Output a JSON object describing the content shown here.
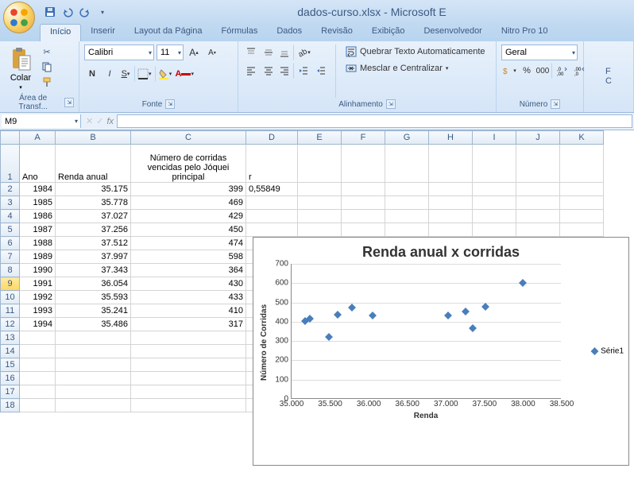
{
  "window": {
    "title": "dados-curso.xlsx - Microsoft E"
  },
  "tabs": {
    "inicio": "Início",
    "inserir": "Inserir",
    "layout": "Layout da Página",
    "formulas": "Fórmulas",
    "dados": "Dados",
    "revisao": "Revisão",
    "exibicao": "Exibição",
    "desenvolvedor": "Desenvolvedor",
    "nitro": "Nitro Pro 10"
  },
  "ribbon": {
    "clipboard": {
      "paste": "Colar",
      "group": "Área de Transf..."
    },
    "font": {
      "name": "Calibri",
      "size": "11",
      "group": "Fonte"
    },
    "align": {
      "wrap": "Quebrar Texto Automaticamente",
      "merge": "Mesclar e Centralizar",
      "group": "Alinhamento"
    },
    "number": {
      "format": "Geral",
      "group": "Número"
    }
  },
  "namebox": "M9",
  "fx": "fx",
  "columns": [
    "A",
    "B",
    "C",
    "D",
    "E",
    "F",
    "G",
    "H",
    "I",
    "J",
    "K"
  ],
  "headers": {
    "A": "Ano",
    "B": "Renda anual",
    "C": "Número de corridas vencidas pelo Jóquei principal",
    "D": "r"
  },
  "rows": [
    {
      "n": 1
    },
    {
      "n": 2,
      "A": "1984",
      "B": "35.175",
      "C": "399",
      "D": "0,55849"
    },
    {
      "n": 3,
      "A": "1985",
      "B": "35.778",
      "C": "469"
    },
    {
      "n": 4,
      "A": "1986",
      "B": "37.027",
      "C": "429"
    },
    {
      "n": 5,
      "A": "1987",
      "B": "37.256",
      "C": "450"
    },
    {
      "n": 6,
      "A": "1988",
      "B": "37.512",
      "C": "474"
    },
    {
      "n": 7,
      "A": "1989",
      "B": "37.997",
      "C": "598"
    },
    {
      "n": 8,
      "A": "1990",
      "B": "37.343",
      "C": "364"
    },
    {
      "n": 9,
      "A": "1991",
      "B": "36.054",
      "C": "430"
    },
    {
      "n": 10,
      "A": "1992",
      "B": "35.593",
      "C": "433"
    },
    {
      "n": 11,
      "A": "1993",
      "B": "35.241",
      "C": "410"
    },
    {
      "n": 12,
      "A": "1994",
      "B": "35.486",
      "C": "317"
    },
    {
      "n": 13
    },
    {
      "n": 14
    },
    {
      "n": 15
    },
    {
      "n": 16
    },
    {
      "n": 17
    },
    {
      "n": 18
    }
  ],
  "chart": {
    "title": "Renda anual x corridas",
    "xlabel": "Renda",
    "ylabel": "Número de Corridas",
    "legend": "Série1"
  },
  "chart_data": {
    "type": "scatter",
    "title": "Renda anual x corridas",
    "xlabel": "Renda",
    "ylabel": "Número de Corridas",
    "xlim": [
      35000,
      38500
    ],
    "ylim": [
      0,
      700
    ],
    "xticks": [
      35000,
      35500,
      36000,
      36500,
      37000,
      37500,
      38000,
      38500
    ],
    "xtick_labels": [
      "35.000",
      "35.500",
      "36.000",
      "36.500",
      "37.000",
      "37.500",
      "38.000",
      "38.500"
    ],
    "yticks": [
      0,
      100,
      200,
      300,
      400,
      500,
      600,
      700
    ],
    "series": [
      {
        "name": "Série1",
        "x": [
          35175,
          35778,
          37027,
          37256,
          37512,
          37997,
          37343,
          36054,
          35593,
          35241,
          35486
        ],
        "y": [
          399,
          469,
          429,
          450,
          474,
          598,
          364,
          430,
          433,
          410,
          317
        ]
      }
    ]
  }
}
